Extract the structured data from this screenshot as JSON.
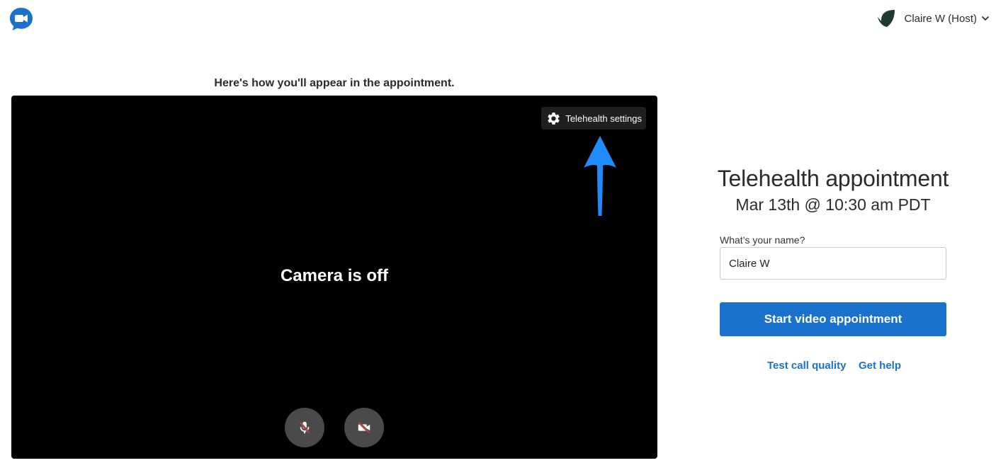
{
  "header": {
    "logo_icon": "chat-video-icon",
    "user": {
      "avatar_icon": "leaf-avatar-icon",
      "name": "Claire W (Host)",
      "menu_icon": "chevron-down-icon"
    }
  },
  "preview": {
    "caption": "Here's how you'll appear in the appointment.",
    "settings_label": "Telehealth settings",
    "settings_icon": "gear-icon",
    "annotation_icon": "arrow-up-icon",
    "camera_status": "Camera is off",
    "mic_icon": "mic-off-icon",
    "camera_icon": "camera-off-icon"
  },
  "appointment": {
    "title": "Telehealth appointment",
    "time": "Mar 13th @ 10:30 am PDT",
    "name_label": "What’s your name?",
    "name_value": "Claire W",
    "start_button": "Start video appointment",
    "test_link": "Test call quality",
    "help_link": "Get help"
  },
  "colors": {
    "accent": "#1a72cc",
    "video_bg": "#000000",
    "annotation_arrow": "#1e8cff",
    "mute_slash": "#e53935"
  }
}
